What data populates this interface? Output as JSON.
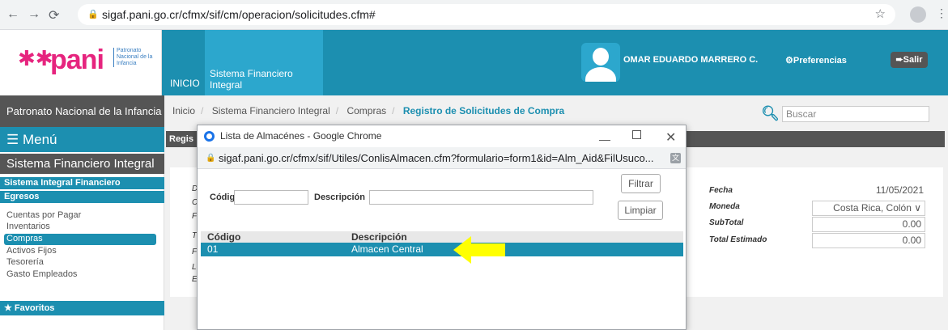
{
  "browser": {
    "url": "sigaf.pani.go.cr/cfmx/sif/cm/operacion/solicitudes.cfm#"
  },
  "header": {
    "logo_text": "pani",
    "logo_subtitle": "Patronato Nacional de la Infancia",
    "tab_inicio": "INICIO",
    "tab_system": "Sistema Financiero Integral",
    "user_name": "OMAR EDUARDO MARRERO C.",
    "preferences": "⚙Preferencias",
    "logout": "➨Salir"
  },
  "org_bar": "Patronato Nacional de la Infancia",
  "breadcrumb": {
    "items": [
      "Inicio",
      "Sistema Financiero Integral",
      "Compras"
    ],
    "active": "Registro de Solicitudes de Compra"
  },
  "search": {
    "placeholder": "Buscar"
  },
  "sidebar": {
    "menu_label": "Menú",
    "title": "Sistema Financiero Integral",
    "section1": "Sistema Integral Financiero",
    "section2": "Egresos",
    "items": [
      "Cuentas por Pagar",
      "Inventarios",
      "Compras",
      "Activos Fijos",
      "Tesorería",
      "Gasto Empleados"
    ],
    "favorites": "★ Favoritos"
  },
  "main": {
    "panel_title": "Regis",
    "fecha_label": "Fecha",
    "fecha_value": "11/05/2021",
    "moneda_label": "Moneda",
    "moneda_value": "Costa Rica, Colón ∨",
    "subtotal_label": "SubTotal",
    "subtotal_value": "0.00",
    "total_label": "Total Estimado",
    "total_value": "0.00",
    "left_stubs": [
      "D",
      "C",
      "F",
      "T",
      "F",
      "L",
      "E"
    ]
  },
  "popup": {
    "title": "Lista de Almacénes - Google Chrome",
    "url": "sigaf.pani.go.cr/cfmx/sif/Utiles/ConlisAlmacen.cfm?formulario=form1&id=Alm_Aid&FilUsuco...",
    "codigo_label": "Código",
    "descripcion_label": "Descripción",
    "filter_btn": "Filtrar",
    "clear_btn": "Limpiar",
    "columns": [
      "Código",
      "Descripción"
    ],
    "rows": [
      {
        "codigo": "01",
        "descripcion": "Almacen Central"
      }
    ]
  },
  "colors": {
    "accent": "#1c8fb0",
    "dark": "#555555",
    "highlight_arrow": "#ffff00"
  }
}
